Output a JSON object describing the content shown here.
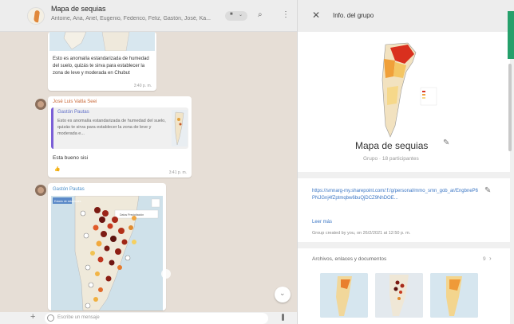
{
  "chat": {
    "title": "Mapa de sequias",
    "members": "Antoine, Ana, Ariel, Eugenio, Federico, Feliz, Gastón, José, Ka..."
  },
  "messages": {
    "m1": {
      "text": "Esto es anomalía estandarizada de humedad del suelo, quizás te sirva para establecer la zona de leve y moderada en Chubut",
      "time": "3:40 p. m."
    },
    "m2": {
      "sender": "José Luis Vaitla Seei",
      "quote_name": "Gastón Pautas",
      "quote_text": "Esto es anomalía estandarizada de humedad del suelo, quizás te sirva para establecer la zona de leve y moderada e...",
      "text": "Esta bueno sisi",
      "time": "3:41 p. m.",
      "reaction": "👍"
    },
    "m3": {
      "sender": "Gastón Pautas",
      "map_label": "Estado de estaciones",
      "legend_label": "Datos Precipitación"
    }
  },
  "composer": {
    "placeholder": "Escribe un mensaje"
  },
  "panel": {
    "header": "Info. del grupo",
    "group_name": "Mapa de sequias",
    "group_subtitle": "Grupo · 18 participantes",
    "link": "https://smnarg-my.sharepoint.com/:f:/g/personal/mmo_smn_gob_ar/EngbneP6PNJGnj4fZptmqbw6buQjDCZ9NhDOE...",
    "see_more": "Leer más",
    "created": "Group created by you, on 26/2/2021 at 12:50 p. m.",
    "files_label": "Archivos, enlaces y documentos",
    "files_count": "9"
  },
  "icons": {
    "search": "search-icon",
    "menu": "menu-icon",
    "close": "close-icon",
    "edit": "pencil-icon",
    "attach": "plus-icon",
    "emoji": "emoji-icon",
    "mic": "microphone-icon"
  },
  "colors": {
    "accent": "#25a06b",
    "link": "#3b76c4"
  }
}
